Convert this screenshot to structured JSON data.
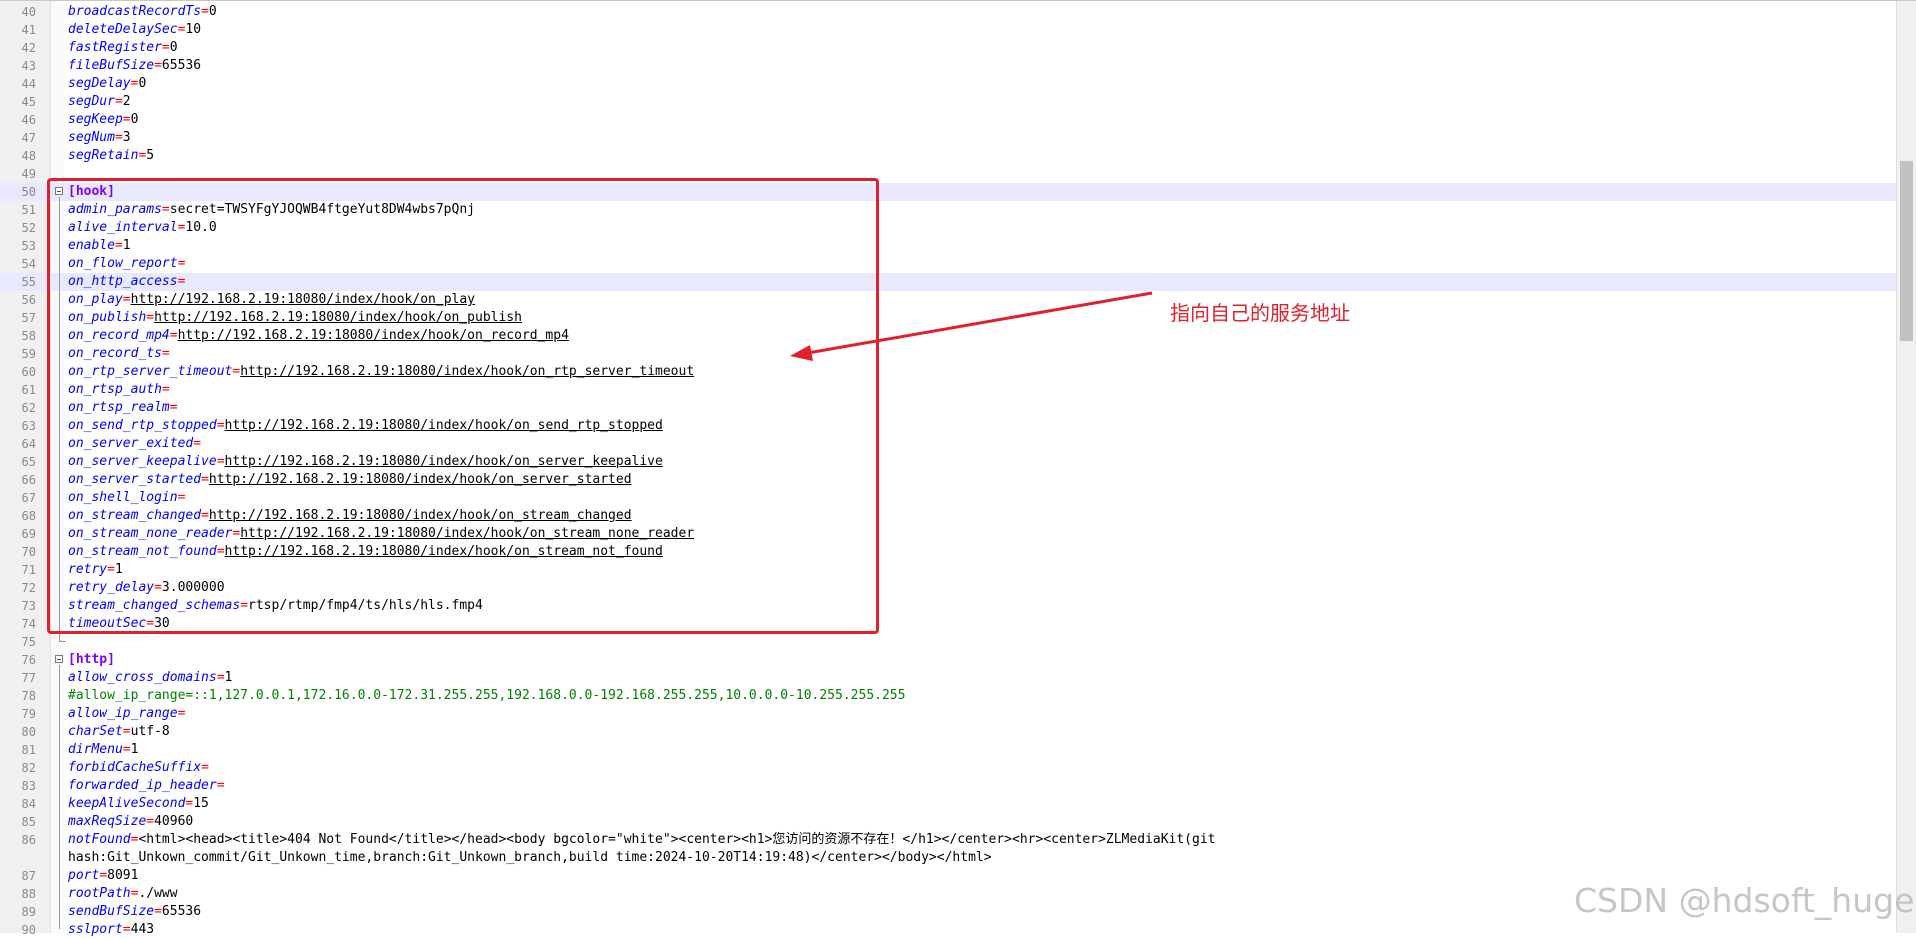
{
  "editor": {
    "lines": [
      {
        "n": "40",
        "k": "broadcastRecordTs",
        "eq": "=",
        "v": "0"
      },
      {
        "n": "41",
        "k": "deleteDelaySec",
        "eq": "=",
        "v": "10"
      },
      {
        "n": "42",
        "k": "fastRegister",
        "eq": "=",
        "v": "0"
      },
      {
        "n": "43",
        "k": "fileBufSize",
        "eq": "=",
        "v": "65536"
      },
      {
        "n": "44",
        "k": "segDelay",
        "eq": "=",
        "v": "0"
      },
      {
        "n": "45",
        "k": "segDur",
        "eq": "=",
        "v": "2"
      },
      {
        "n": "46",
        "k": "segKeep",
        "eq": "=",
        "v": "0"
      },
      {
        "n": "47",
        "k": "segNum",
        "eq": "=",
        "v": "3"
      },
      {
        "n": "48",
        "k": "segRetain",
        "eq": "=",
        "v": "5"
      },
      {
        "n": "49",
        "type": "blank"
      },
      {
        "n": "50",
        "type": "section",
        "v": "[hook]"
      },
      {
        "n": "51",
        "k": "admin_params",
        "eq": "=",
        "v": "secret=TWSYFgYJOQWB4ftgeYut8DW4wbs7pQnj"
      },
      {
        "n": "52",
        "k": "alive_interval",
        "eq": "=",
        "v": "10.0"
      },
      {
        "n": "53",
        "k": "enable",
        "eq": "=",
        "v": "1"
      },
      {
        "n": "54",
        "k": "on_flow_report",
        "eq": "=",
        "v": ""
      },
      {
        "n": "55",
        "k": "on_http_access",
        "eq": "=",
        "v": ""
      },
      {
        "n": "56",
        "k": "on_play",
        "eq": "=",
        "v": "http://192.168.2.19:18080/index/hook/on_play",
        "link": true
      },
      {
        "n": "57",
        "k": "on_publish",
        "eq": "=",
        "v": "http://192.168.2.19:18080/index/hook/on_publish",
        "link": true
      },
      {
        "n": "58",
        "k": "on_record_mp4",
        "eq": "=",
        "v": "http://192.168.2.19:18080/index/hook/on_record_mp4",
        "link": true
      },
      {
        "n": "59",
        "k": "on_record_ts",
        "eq": "=",
        "v": ""
      },
      {
        "n": "60",
        "k": "on_rtp_server_timeout",
        "eq": "=",
        "v": "http://192.168.2.19:18080/index/hook/on_rtp_server_timeout",
        "link": true
      },
      {
        "n": "61",
        "k": "on_rtsp_auth",
        "eq": "=",
        "v": ""
      },
      {
        "n": "62",
        "k": "on_rtsp_realm",
        "eq": "=",
        "v": ""
      },
      {
        "n": "63",
        "k": "on_send_rtp_stopped",
        "eq": "=",
        "v": "http://192.168.2.19:18080/index/hook/on_send_rtp_stopped",
        "link": true
      },
      {
        "n": "64",
        "k": "on_server_exited",
        "eq": "=",
        "v": ""
      },
      {
        "n": "65",
        "k": "on_server_keepalive",
        "eq": "=",
        "v": "http://192.168.2.19:18080/index/hook/on_server_keepalive",
        "link": true
      },
      {
        "n": "66",
        "k": "on_server_started",
        "eq": "=",
        "v": "http://192.168.2.19:18080/index/hook/on_server_started",
        "link": true
      },
      {
        "n": "67",
        "k": "on_shell_login",
        "eq": "=",
        "v": ""
      },
      {
        "n": "68",
        "k": "on_stream_changed",
        "eq": "=",
        "v": "http://192.168.2.19:18080/index/hook/on_stream_changed",
        "link": true
      },
      {
        "n": "69",
        "k": "on_stream_none_reader",
        "eq": "=",
        "v": "http://192.168.2.19:18080/index/hook/on_stream_none_reader",
        "link": true
      },
      {
        "n": "70",
        "k": "on_stream_not_found",
        "eq": "=",
        "v": "http://192.168.2.19:18080/index/hook/on_stream_not_found",
        "link": true
      },
      {
        "n": "71",
        "k": "retry",
        "eq": "=",
        "v": "1"
      },
      {
        "n": "72",
        "k": "retry_delay",
        "eq": "=",
        "v": "3.000000"
      },
      {
        "n": "73",
        "k": "stream_changed_schemas",
        "eq": "=",
        "v": "rtsp/rtmp/fmp4/ts/hls/hls.fmp4"
      },
      {
        "n": "74",
        "k": "timeoutSec",
        "eq": "=",
        "v": "30"
      },
      {
        "n": "75",
        "type": "blank"
      },
      {
        "n": "76",
        "type": "section",
        "v": "[http]"
      },
      {
        "n": "77",
        "k": "allow_cross_domains",
        "eq": "=",
        "v": "1"
      },
      {
        "n": "78",
        "type": "comment",
        "v": "#allow_ip_range=::1,127.0.0.1,172.16.0.0-172.31.255.255,192.168.0.0-192.168.255.255,10.0.0.0-10.255.255.255"
      },
      {
        "n": "79",
        "k": "allow_ip_range",
        "eq": "=",
        "v": ""
      },
      {
        "n": "80",
        "k": "charSet",
        "eq": "=",
        "v": "utf-8"
      },
      {
        "n": "81",
        "k": "dirMenu",
        "eq": "=",
        "v": "1"
      },
      {
        "n": "82",
        "k": "forbidCacheSuffix",
        "eq": "=",
        "v": ""
      },
      {
        "n": "83",
        "k": "forwarded_ip_header",
        "eq": "=",
        "v": ""
      },
      {
        "n": "84",
        "k": "keepAliveSecond",
        "eq": "=",
        "v": "15"
      },
      {
        "n": "85",
        "k": "maxReqSize",
        "eq": "=",
        "v": "40960"
      },
      {
        "n": "86",
        "k": "notFound",
        "eq": "=",
        "v": "<html><head><title>404 Not Found</title></head><body bgcolor=\"white\"><center><h1>您访问的资源不存在！</h1></center><hr><center>ZLMediaKit(git"
      },
      {
        "n": "",
        "type": "wrap",
        "v": "hash:Git_Unkown_commit/Git_Unkown_time,branch:Git_Unkown_branch,build time:2024-10-20T14:19:48)</center></body></html>"
      },
      {
        "n": "87",
        "k": "port",
        "eq": "=",
        "v": "8091"
      },
      {
        "n": "88",
        "k": "rootPath",
        "eq": "=",
        "v": "./www"
      },
      {
        "n": "89",
        "k": "sendBufSize",
        "eq": "=",
        "v": "65536"
      },
      {
        "n": "90",
        "k": "sslport",
        "eq": "=",
        "v": "443"
      }
    ],
    "highlighted_lines": [
      "50",
      "55"
    ]
  },
  "annotation": {
    "text": "指向自己的服务地址",
    "color": "#e0202a"
  },
  "watermark": {
    "text": "CSDN @hdsoft_huge"
  }
}
